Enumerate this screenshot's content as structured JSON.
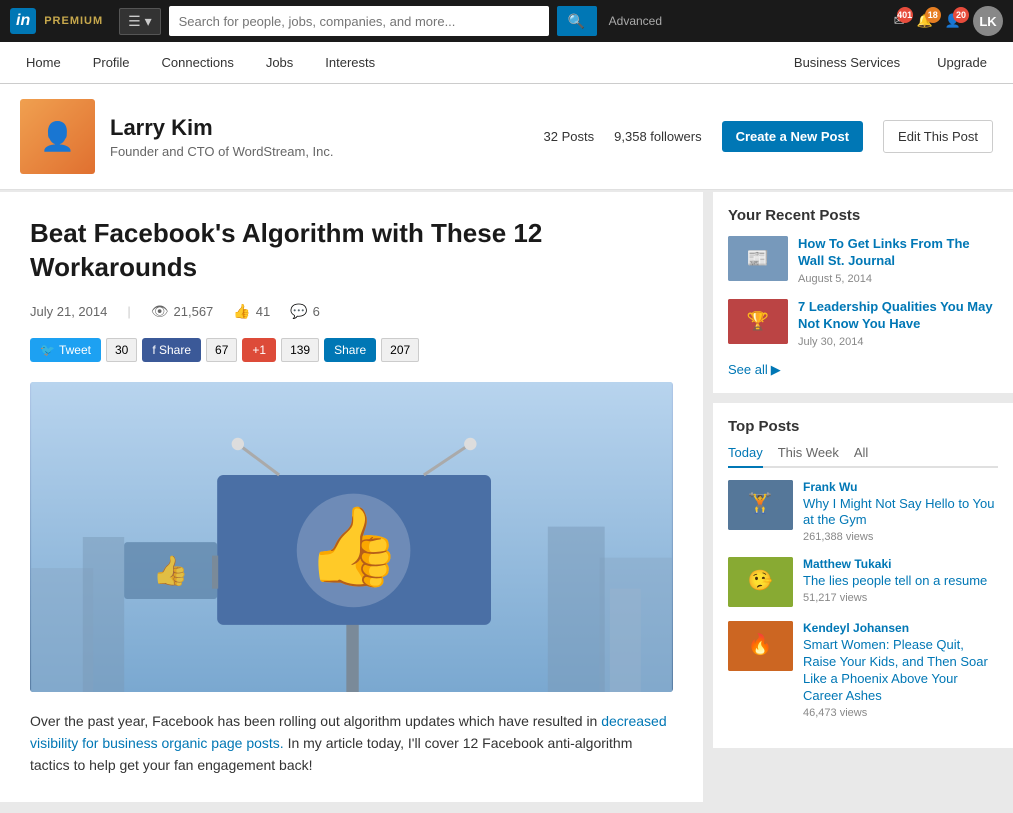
{
  "brand": {
    "logo": "in",
    "premium": "PREMIUM"
  },
  "topnav": {
    "search_placeholder": "Search for people, jobs, companies, and more...",
    "search_btn_icon": "🔍",
    "advanced": "Advanced",
    "notifications": {
      "mail_count": "401",
      "alert_count": "18",
      "connections_count": "20"
    }
  },
  "secnav": {
    "items": [
      {
        "label": "Home",
        "active": false
      },
      {
        "label": "Profile",
        "active": false
      },
      {
        "label": "Connections",
        "active": false
      },
      {
        "label": "Jobs",
        "active": false
      },
      {
        "label": "Interests",
        "active": false
      }
    ],
    "right_items": [
      {
        "label": "Business Services",
        "active": false
      },
      {
        "label": "Upgrade",
        "active": false
      }
    ]
  },
  "profile": {
    "name": "Larry Kim",
    "title": "Founder and CTO of WordStream, Inc.",
    "posts_count": "32 Posts",
    "followers": "9,358 followers",
    "btn_create": "Create a New Post",
    "btn_edit": "Edit This Post"
  },
  "article": {
    "title": "Beat Facebook's Algorithm with These 12 Workarounds",
    "date": "July 21, 2014",
    "views": "21,567",
    "likes": "41",
    "comments": "6",
    "share_tweet_label": "Tweet",
    "share_tweet_count": "30",
    "share_fb_label": "f Share",
    "share_fb_count": "67",
    "share_gplus_label": "+1",
    "share_gplus_count": "139",
    "share_li_label": "Share",
    "share_li_count": "207",
    "body_text": "Over the past year, Facebook has been rolling out algorithm updates which have resulted in ",
    "body_link": "decreased visibility for business organic page posts.",
    "body_text2": " In my article today, I'll cover 12 Facebook anti-algorithm tactics to help get your fan engagement back!"
  },
  "sidebar": {
    "recent_title": "Your Recent Posts",
    "recent_posts": [
      {
        "title": "How To Get Links From The Wall St. Journal",
        "date": "August 5, 2014"
      },
      {
        "title": "7 Leadership Qualities You May Not Know You Have",
        "date": "July 30, 2014"
      }
    ],
    "see_all": "See all",
    "top_posts_title": "Top Posts",
    "top_tabs": [
      "Today",
      "This Week",
      "All"
    ],
    "active_tab": "Today",
    "top_posts": [
      {
        "author": "Frank Wu",
        "title": "Why I Might Not Say Hello to You at the Gym",
        "views": "261,388 views"
      },
      {
        "author": "Matthew Tukaki",
        "title": "The lies people tell on a resume",
        "views": "51,217 views"
      },
      {
        "author": "Kendeyl Johansen",
        "title": "Smart Women: Please Quit, Raise Your Kids, and Then Soar Like a Phoenix Above Your Career Ashes",
        "views": "46,473 views"
      }
    ]
  }
}
